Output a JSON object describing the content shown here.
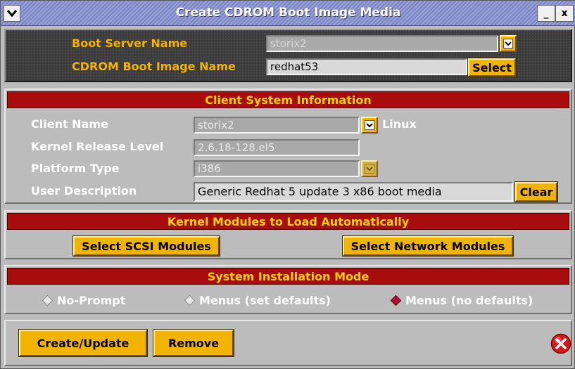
{
  "window": {
    "title": "Create CDROM Boot Image Media",
    "menu_icon": "chevron-down-icon",
    "minimize_label": "_",
    "close_label": "x"
  },
  "boot": {
    "server_label": "Boot Server Name",
    "server_value": "storix2",
    "image_label": "CDROM Boot Image Name",
    "image_value": "redhat53",
    "select_label": "Select"
  },
  "client": {
    "header": "Client System Information",
    "name_label": "Client Name",
    "name_value": "storix2",
    "os_label": "Linux",
    "kernel_label": "Kernel Release Level",
    "kernel_value": "2.6.18-128.el5",
    "platform_label": "Platform Type",
    "platform_value": "i386",
    "desc_label": "User Description",
    "desc_value": "Generic Redhat 5 update 3 x86 boot media",
    "clear_label": "Clear"
  },
  "modules": {
    "header": "Kernel Modules to Load Automatically",
    "scsi_label": "Select SCSI Modules",
    "network_label": "Select Network Modules"
  },
  "install": {
    "header": "System Installation Mode",
    "options": [
      "No-Prompt",
      "Menus (set defaults)",
      "Menus (no defaults)"
    ],
    "selected": "Menus (no defaults)"
  },
  "actions": {
    "create_label": "Create/Update",
    "remove_label": "Remove",
    "cancel_icon": "red-x-circle-icon"
  },
  "colors": {
    "accent": "#f2b400",
    "section_header_bg": "#a80c0c",
    "section_header_text": "#ffd400",
    "selected_radio": "#b01038"
  }
}
